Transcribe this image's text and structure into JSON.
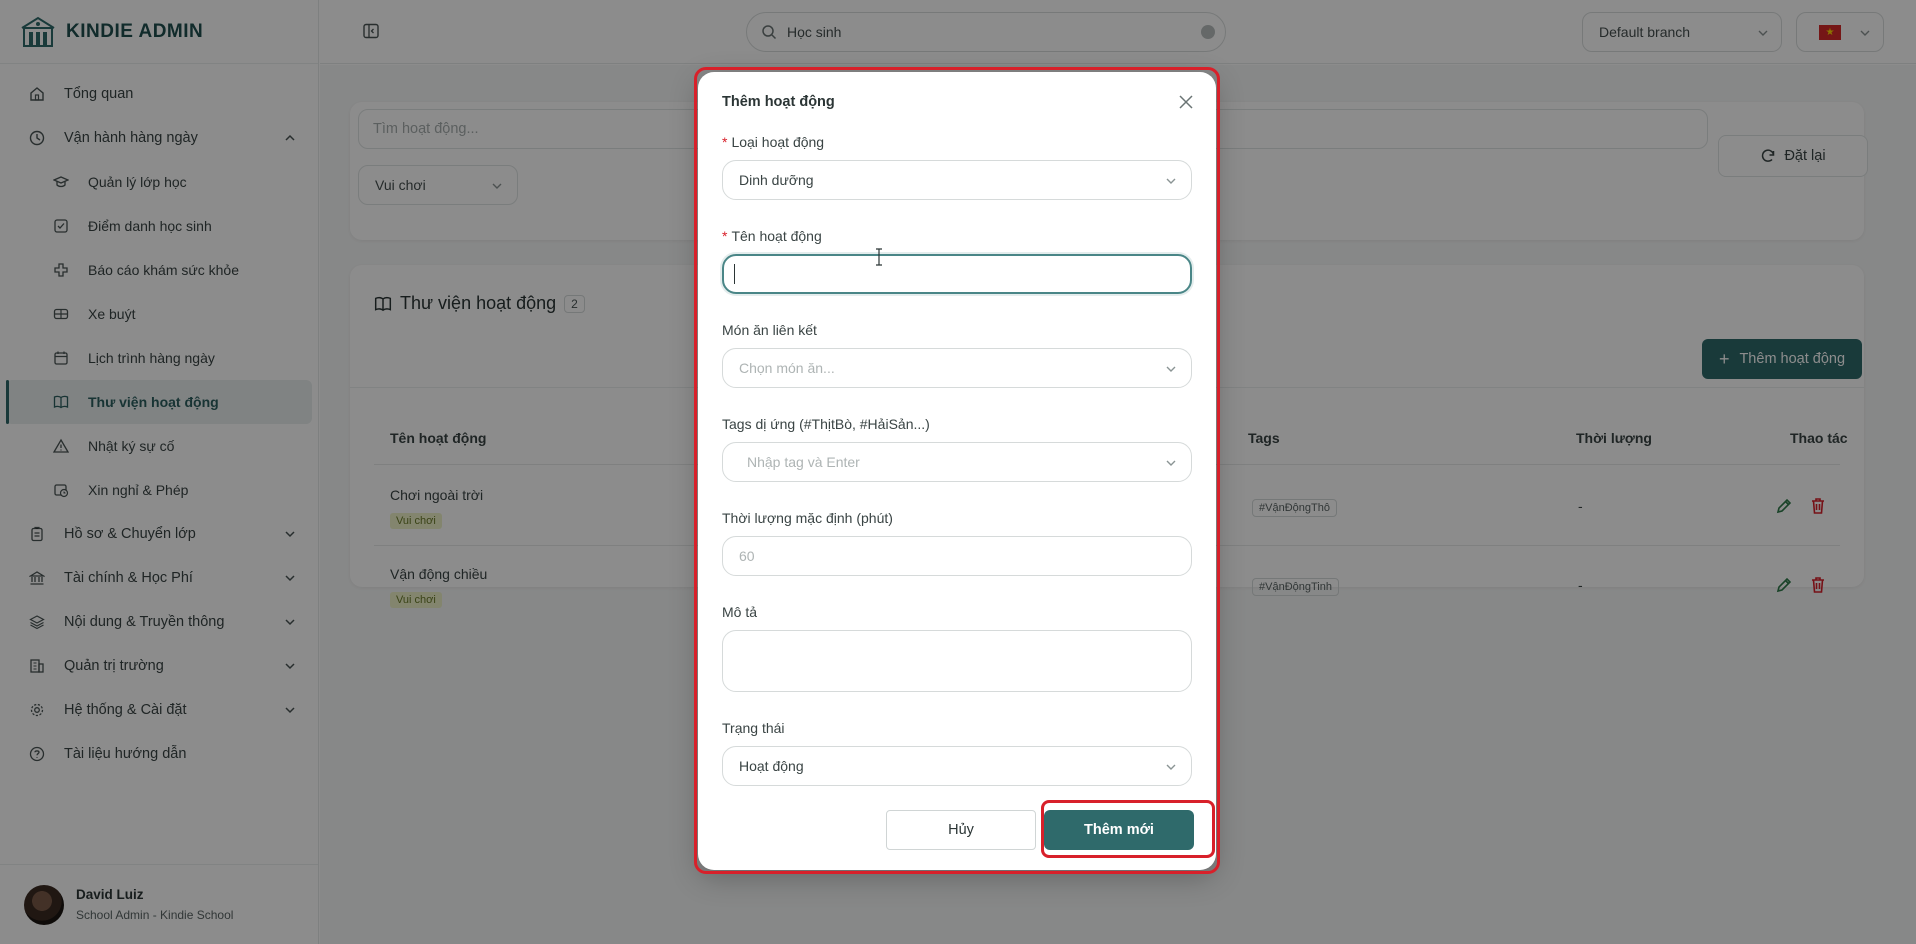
{
  "brand": {
    "name": "KINDIE ADMIN"
  },
  "sidebar": {
    "items": [
      {
        "label": "Tổng quan",
        "icon": "home-icon"
      },
      {
        "label": "Vận hành hàng ngày",
        "icon": "clock-icon",
        "expanded": true
      }
    ],
    "sub_items": [
      {
        "label": "Quản lý lớp học",
        "icon": "graduation-cap-icon"
      },
      {
        "label": "Điểm danh học sinh",
        "icon": "checkbox-icon"
      },
      {
        "label": "Báo cáo khám sức khỏe",
        "icon": "health-cross-icon"
      },
      {
        "label": "Xe buýt",
        "icon": "bus-icon"
      },
      {
        "label": "Lịch trình hàng ngày",
        "icon": "calendar-icon"
      },
      {
        "label": "Thư viện hoạt động",
        "icon": "book-icon",
        "active": true
      },
      {
        "label": "Nhật ký sự cố",
        "icon": "warning-icon"
      },
      {
        "label": "Xin nghỉ & Phép",
        "icon": "calendar-clock-icon"
      }
    ],
    "groups": [
      {
        "label": "Hồ sơ & Chuyển lớp",
        "icon": "clipboard-icon"
      },
      {
        "label": "Tài chính & Học Phí",
        "icon": "bank-icon"
      },
      {
        "label": "Nội dung & Truyền thông",
        "icon": "layers-icon"
      },
      {
        "label": "Quản trị trường",
        "icon": "building-icon"
      },
      {
        "label": "Hệ thống & Cài đặt",
        "icon": "gear-icon"
      }
    ],
    "help": {
      "label": "Tài liệu hướng dẫn",
      "icon": "help-circle-icon"
    }
  },
  "user": {
    "name": "David Luiz",
    "role": "School Admin - Kindie School"
  },
  "topbar": {
    "search_value": "Học sinh",
    "branch": "Default branch",
    "language": "vi"
  },
  "filters": {
    "search_placeholder": "Tìm hoạt động...",
    "type_select": "Vui chơi",
    "reset_label": "Đặt lại"
  },
  "library": {
    "title": "Thư viện hoạt động",
    "count": "2",
    "add_label": "Thêm hoạt động",
    "columns": [
      "Tên hoạt động",
      "Tags",
      "Thời lượng",
      "Thao tác"
    ],
    "rows": [
      {
        "name": "Chơi ngoài trời",
        "category": "Vui chơi",
        "tag": "#VậnĐộngThô",
        "duration": "-"
      },
      {
        "name": "Vận động chiều",
        "category": "Vui chơi",
        "tag": "#VậnĐộngTinh",
        "duration": "-"
      }
    ]
  },
  "modal": {
    "title": "Thêm hoạt động",
    "type_label": "Loại hoạt động",
    "type_value": "Dinh dưỡng",
    "name_label": "Tên hoạt động",
    "name_value": "",
    "dish_label": "Món ăn liên kết",
    "dish_placeholder": "Chọn món ăn...",
    "allergy_label": "Tags dị ứng (#ThịtBò, #HảiSản...)",
    "allergy_placeholder": "Nhập tag và Enter",
    "duration_label": "Thời lượng mặc định (phút)",
    "duration_placeholder": "60",
    "desc_label": "Mô tả",
    "status_label": "Trạng thái",
    "status_value": "Hoạt động",
    "cancel_label": "Hủy",
    "submit_label": "Thêm mới"
  },
  "colors": {
    "primary": "#2f6a6b",
    "highlight": "#d8202a",
    "category_tag_bg": "#eef3c8",
    "delete": "#d8202a"
  }
}
